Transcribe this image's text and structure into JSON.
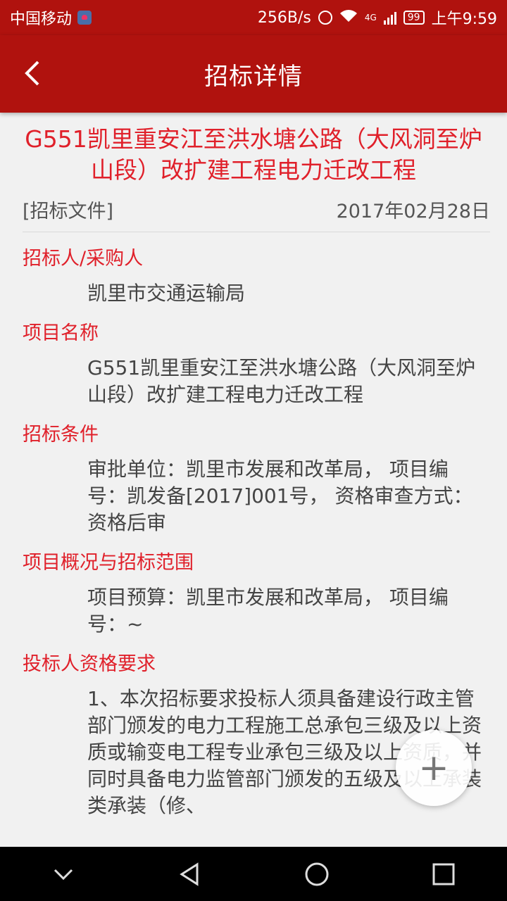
{
  "status_bar": {
    "carrier": "中国移动",
    "speed": "256B/s",
    "network": "4G",
    "battery": "99",
    "time": "上午9:59"
  },
  "app_bar": {
    "title": "招标详情"
  },
  "document": {
    "title": "G551凯里重安江至洪水塘公路（大风洞至炉山段）改扩建工程电力迁改工程",
    "type": "[招标文件]",
    "date": "2017年02月28日"
  },
  "sections": [
    {
      "label": "招标人/采购人",
      "body": "凯里市交通运输局"
    },
    {
      "label": "项目名称",
      "body": "G551凯里重安江至洪水塘公路（大风洞至炉山段）改扩建工程电力迁改工程"
    },
    {
      "label": "招标条件",
      "body": "审批单位：凯里市发展和改革局， 项目编号：凯发备[2017]001号， 资格审查方式：资格后审"
    },
    {
      "label": "项目概况与招标范围",
      "body": "项目预算：凯里市发展和改革局， 项目编号：~"
    },
    {
      "label": "投标人资格要求",
      "body": "1、本次招标要求投标人须具备建设行政主管部门颁发的电力工程施工总承包三级及以上资质或输变电工程专业承包三级及以上资质，并同时具备电力监管部门颁发的五级及以上承装类承装（修、"
    }
  ],
  "fab": {
    "label": "+"
  }
}
